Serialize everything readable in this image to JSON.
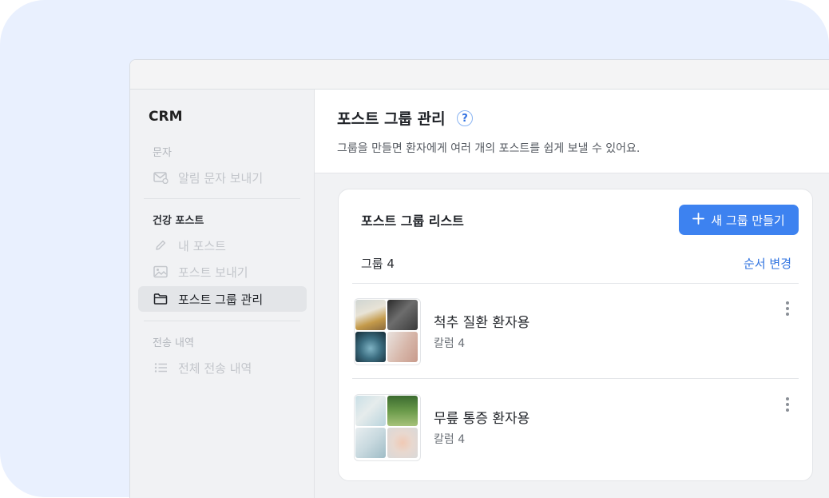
{
  "sidebar": {
    "brand": "CRM",
    "sections": [
      {
        "label": "문자",
        "items": [
          {
            "label": "알림 문자 보내기",
            "icon": "mail-icon"
          }
        ]
      },
      {
        "label": "건강 포스트",
        "items": [
          {
            "label": "내 포스트",
            "icon": "pencil-icon"
          },
          {
            "label": "포스트 보내기",
            "icon": "image-icon"
          },
          {
            "label": "포스트 그룹 관리",
            "icon": "folder-icon",
            "active": true
          }
        ]
      },
      {
        "label": "전송 내역",
        "items": [
          {
            "label": "전체 전송 내역",
            "icon": "list-icon"
          }
        ]
      }
    ]
  },
  "header": {
    "title": "포스트 그룹 관리",
    "help": "?",
    "description": "그룹을 만들면 환자에게 여러 개의 포스트를 쉽게 보낼 수 있어요."
  },
  "card": {
    "title": "포스트 그룹 리스트",
    "new_button": "새 그룹 만들기",
    "count": "그룹 4",
    "reorder": "순서 변경",
    "groups": [
      {
        "name": "척추 질환 환자용",
        "sub": "칼럼 4"
      },
      {
        "name": "무릎 통증 환자용",
        "sub": "칼럼 4"
      }
    ]
  },
  "colors": {
    "accent": "#3d82f0",
    "link": "#2f73e0",
    "background": "#e9f0fe"
  }
}
